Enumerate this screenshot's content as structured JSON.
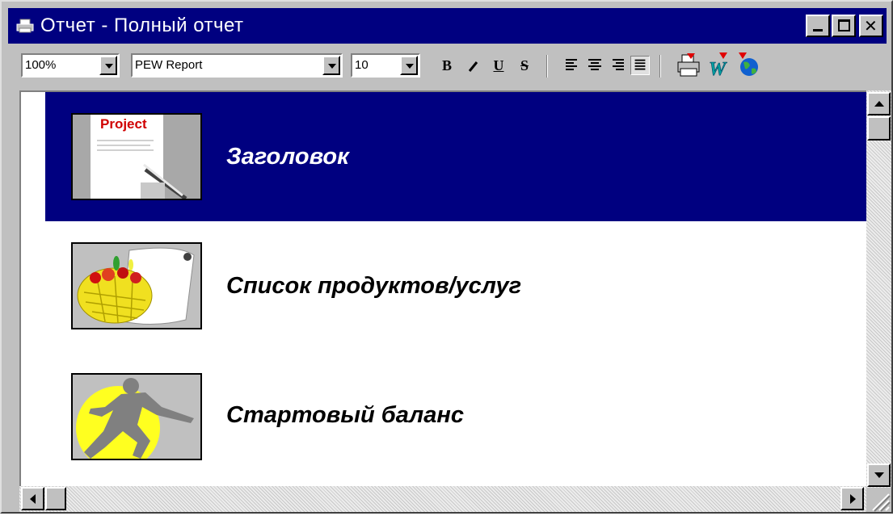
{
  "window": {
    "title": "Отчет - Полный отчет",
    "minimize_icon": "minimize-icon",
    "maximize_icon": "maximize-icon",
    "close_icon": "close-icon"
  },
  "toolbar": {
    "zoom": {
      "value": "100%"
    },
    "font": {
      "value": "PEW Report"
    },
    "size": {
      "value": "10"
    },
    "bold_label": "B",
    "italic_label": "I",
    "underline_label": "U",
    "strike_label": "S",
    "icons": [
      "align-left-icon",
      "align-center-icon",
      "align-right-icon",
      "align-justify-icon",
      "print-icon",
      "export-word-icon",
      "export-web-icon"
    ]
  },
  "report": {
    "items": [
      {
        "label": "Заголовок",
        "thumb_text": "Project",
        "icon": "project-document-icon",
        "selected": true
      },
      {
        "label": "Список продуктов/услуг",
        "icon": "fruit-basket-icon",
        "selected": false
      },
      {
        "label": "Стартовый баланс",
        "icon": "runner-icon",
        "selected": false
      }
    ]
  },
  "colors": {
    "titlebar": "#000080",
    "selection": "#000080",
    "face": "#c0c0c0"
  }
}
